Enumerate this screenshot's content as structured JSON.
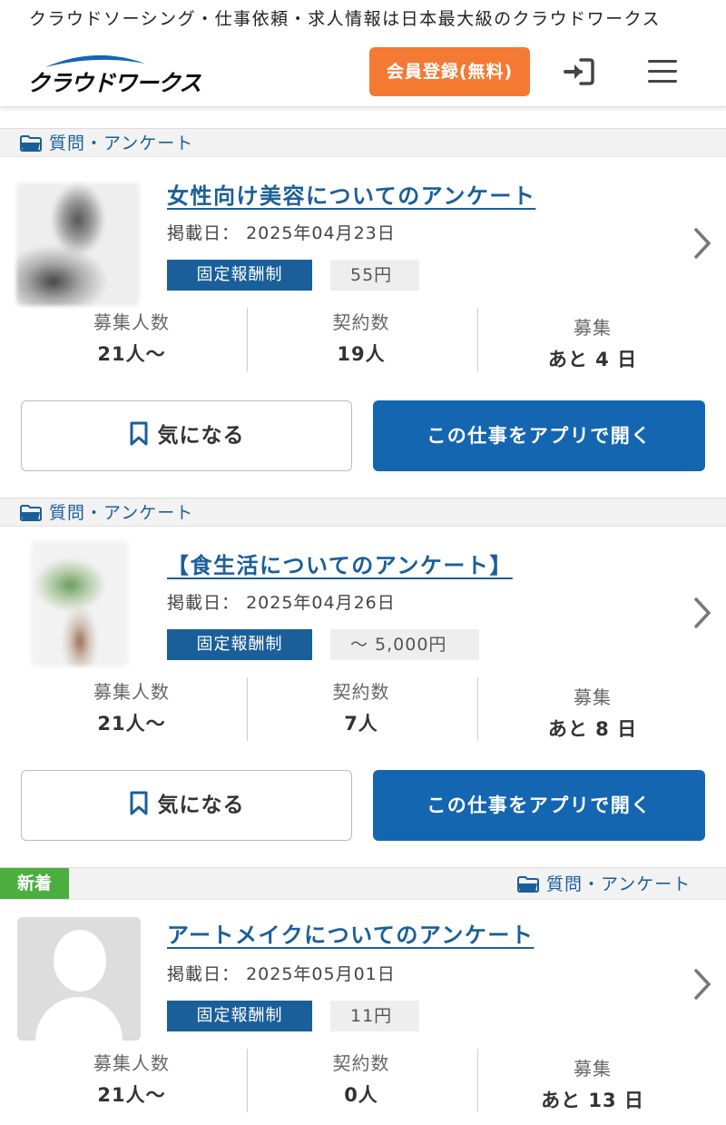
{
  "tagline": "クラウドソーシング・仕事依頼・求人情報は日本最大級のクラウドワークス",
  "header": {
    "logo_text": "クラウドワークス",
    "register_label": "会員登録(無料)"
  },
  "labels": {
    "date_prefix": "掲載日：",
    "recruit_count": "募集人数",
    "contracts": "契約数",
    "recruiting": "募集",
    "favorite": "気になる",
    "open_in_app": "この仕事をアプリで開く"
  },
  "jobs": [
    {
      "category": "質問・アンケート",
      "title": "女性向け美容についてのアンケート",
      "date": "2025年04月23日",
      "pay_type": "固定報酬制",
      "pay_amount": "55円",
      "recruit_count": "21人〜",
      "contracts": "19人",
      "remaining": "あと 4 日"
    },
    {
      "category": "質問・アンケート",
      "title": "【食生活についてのアンケート】",
      "date": "2025年04月26日",
      "pay_type": "固定報酬制",
      "pay_amount": "〜 5,000円",
      "recruit_count": "21人〜",
      "contracts": "7人",
      "remaining": "あと 8 日"
    },
    {
      "badge": "新着",
      "category": "質問・アンケート",
      "title": "アートメイクについてのアンケート",
      "date": "2025年05月01日",
      "pay_type": "固定報酬制",
      "pay_amount": "11円",
      "recruit_count": "21人〜",
      "contracts": "0人",
      "remaining": "あと 13 日"
    }
  ],
  "colors": {
    "brand_blue": "#1466b1",
    "link_blue": "#1a5f99",
    "register_orange": "#f47a34",
    "new_green": "#4cae3f"
  },
  "icons": [
    "folder-icon",
    "bookmark-icon",
    "chevron-right-icon",
    "login-icon",
    "hamburger-menu-icon"
  ]
}
